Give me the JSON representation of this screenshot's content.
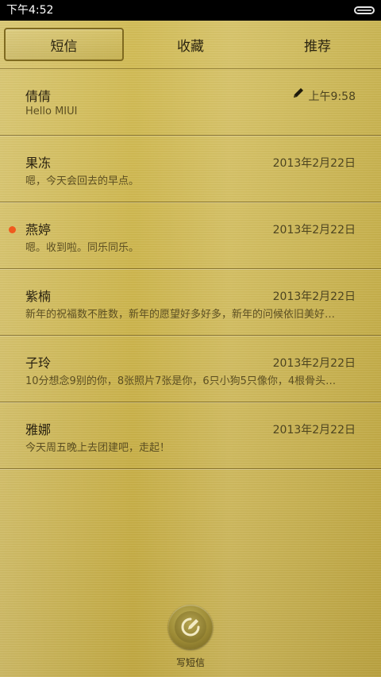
{
  "status_bar": {
    "time": "下午4:52"
  },
  "tabs": [
    {
      "label": "短信"
    },
    {
      "label": "收藏"
    },
    {
      "label": "推荐"
    }
  ],
  "conversations": [
    {
      "name": "倩倩",
      "preview": "Hello MIUI",
      "date": "上午9:58",
      "draft": true,
      "unread": false
    },
    {
      "name": "果冻",
      "preview": "嗯，今天会回去的早点。",
      "date": "2013年2月22日",
      "draft": false,
      "unread": false
    },
    {
      "name": "燕婷",
      "preview": "嗯。收到啦。同乐同乐。",
      "date": "2013年2月22日",
      "draft": false,
      "unread": true
    },
    {
      "name": "紫楠",
      "preview": "新年的祝福数不胜数，新年的愿望好多好多，新年的问候依旧美好…",
      "date": "2013年2月22日",
      "draft": false,
      "unread": false
    },
    {
      "name": "子玲",
      "preview": "10分想念9别的你，8张照片7张是你，6只小狗5只像你，4根骨头…",
      "date": "2013年2月22日",
      "draft": false,
      "unread": false
    },
    {
      "name": "雅娜",
      "preview": "今天周五晚上去团建吧，走起！",
      "date": "2013年2月22日",
      "draft": false,
      "unread": false
    }
  ],
  "compose": {
    "label": "写短信",
    "icon": "compose-icon"
  },
  "colors": {
    "accent_unread": "#f05a1e",
    "background_gold": "#c9b24a",
    "tab_active_border": "#7f6a20"
  }
}
